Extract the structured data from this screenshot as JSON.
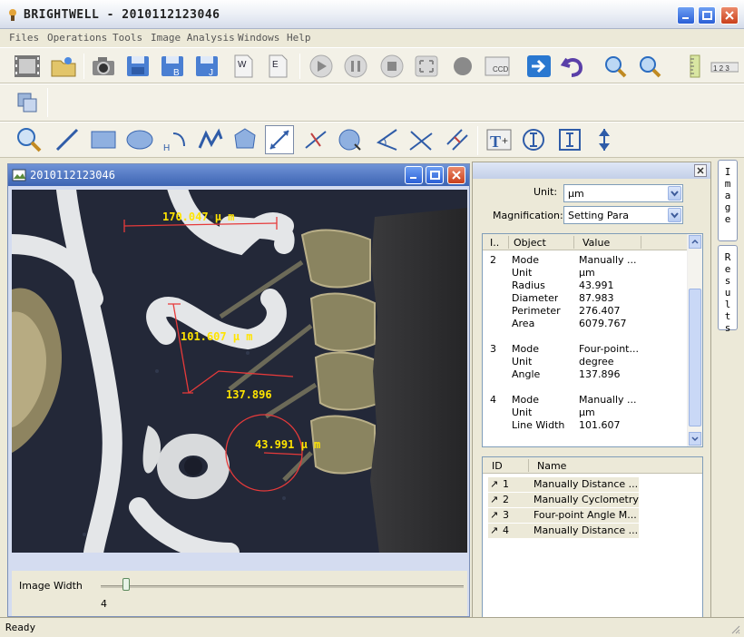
{
  "app": {
    "title": "BRIGHTWELL - 2010112123046"
  },
  "menu": [
    "Files",
    "Operations",
    "Tools",
    "Image Analysis",
    "Windows",
    "Help"
  ],
  "child_window": {
    "title": "2010112123046"
  },
  "measurements": {
    "line_width": "170.047 μ m",
    "diameter_label": "101.607 μ m",
    "angle_label": "137.896",
    "circle_label": "43.991 μ m"
  },
  "image_width": {
    "label": "Image Width",
    "value": "4",
    "fraction": 0.06
  },
  "panel": {
    "unit_label": "Unit:",
    "unit_value": "μm",
    "magnification_label": "Magnification:",
    "magnification_value": "Setting Para"
  },
  "grid": {
    "headers": [
      "I..",
      "Object",
      "Value"
    ],
    "rows": [
      {
        "id": "2",
        "object": "Mode",
        "value": "Manually ..."
      },
      {
        "id": "",
        "object": "Unit",
        "value": "μm"
      },
      {
        "id": "",
        "object": "Radius",
        "value": "43.991"
      },
      {
        "id": "",
        "object": "Diameter",
        "value": "87.983"
      },
      {
        "id": "",
        "object": "Perimeter",
        "value": "276.407"
      },
      {
        "id": "",
        "object": "Area",
        "value": "6079.767"
      },
      {
        "id": "",
        "object": "",
        "value": ""
      },
      {
        "id": "3",
        "object": "Mode",
        "value": "Four-point..."
      },
      {
        "id": "",
        "object": "Unit",
        "value": "degree"
      },
      {
        "id": "",
        "object": "Angle",
        "value": "137.896"
      },
      {
        "id": "",
        "object": "",
        "value": ""
      },
      {
        "id": "4",
        "object": "Mode",
        "value": "Manually ..."
      },
      {
        "id": "",
        "object": "Unit",
        "value": "μm"
      },
      {
        "id": "",
        "object": "Line Width",
        "value": "101.607"
      }
    ]
  },
  "list": {
    "headers": [
      "ID",
      "Name"
    ],
    "rows": [
      {
        "id": "1",
        "name": "Manually Distance ..."
      },
      {
        "id": "2",
        "name": "Manually Cyclometry"
      },
      {
        "id": "3",
        "name": "Four-point Angle M..."
      },
      {
        "id": "4",
        "name": "Manually Distance ..."
      }
    ]
  },
  "side_tabs": [
    "Image",
    "Results"
  ],
  "status": "Ready"
}
